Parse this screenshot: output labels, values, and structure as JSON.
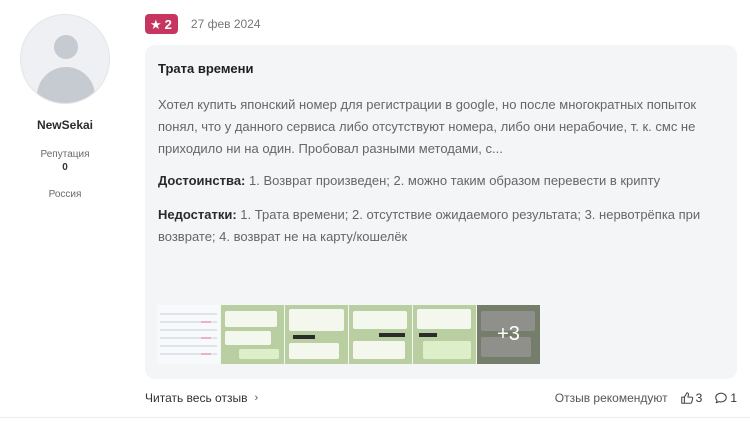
{
  "user": {
    "name": "NewSekai",
    "reputation_label": "Репутация",
    "reputation_value": "0",
    "country": "Россия"
  },
  "review": {
    "rating": "2",
    "date": "27 фев 2024",
    "title": "Трата времени",
    "text": "Хотел купить японский номер для регистрации в google, но после многократных попыток понял, что у данного сервиса либо отсутствуют номера, либо они нерабочие, т. к. смс не приходило ни на один. Пробовал разными методами, с...",
    "pros_label": "Достоинства:",
    "pros_text": "1. Возврат произведен; 2. можно таким образом перевести в крипту",
    "cons_label": "Недостатки:",
    "cons_text": "1. Трата времени; 2. отсутствие ожидаемого результата; 3. нервотрёпка при возврате; 4. возврат не на карту/кошелёк",
    "more_photos": "+3"
  },
  "footer": {
    "read_full": "Читать весь отзыв",
    "recommend_label": "Отзыв рекомендуют",
    "likes": "3",
    "comments": "1"
  },
  "colors": {
    "rating_badge": "#c7365f",
    "card_bg": "#f4f5f7"
  }
}
